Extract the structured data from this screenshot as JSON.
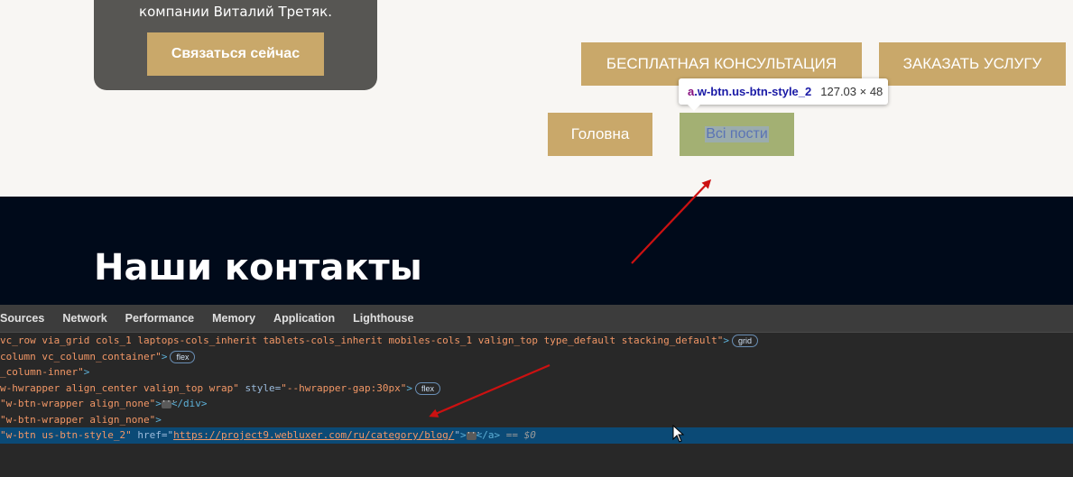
{
  "page": {
    "promo_text": "компании Виталий Третяк.",
    "contact_button": "Связаться сейчас",
    "free_consultation_button": "БЕСПЛАТНАЯ КОНСУЛЬТАЦИЯ",
    "order_service_button": "ЗАКАЗАТЬ УСЛУГУ",
    "home_button": "Головна",
    "all_posts_button": "Всі пости",
    "contacts_heading": "Наши контакты"
  },
  "tooltip": {
    "tag": "a",
    "classes": ".w-btn.us-btn-style_2",
    "size": "127.03 × 48"
  },
  "devtools": {
    "tabs": [
      "Sources",
      "Network",
      "Performance",
      "Memory",
      "Application",
      "Lighthouse"
    ],
    "lines": {
      "l1_value": " vc_row via_grid cols_1 laptops-cols_inherit tablets-cols_inherit mobiles-cols_1 valign_top type_default stacking_default\"",
      "l1_badge": "grid",
      "l2_value": "column vc_column_container\"",
      "l2_badge": "flex",
      "l3_value": "_column-inner\"",
      "l4_value": "w-hwrapper align_center valign_top wrap\"",
      "l4_attr": "style",
      "l4_style": "\"--hwrapper-gap:30px\"",
      "l4_badge": "flex",
      "l5_value": "\"w-btn-wrapper align_none\"",
      "l5_close": "</div>",
      "l6_value": "\"w-btn-wrapper align_none\"",
      "l7_value": "\"w-btn us-btn-style_2\"",
      "l7_attr": "href",
      "l7_href": "https://project9.webluxer.com/ru/category/blog/",
      "l7_close": "</a>",
      "l7_eq": "==",
      "l7_ref": "$0"
    }
  },
  "colors": {
    "gold": "#c9a86a",
    "dark_card": "#575653",
    "navy": "#000a1a",
    "annotation_arrow": "#cc1111"
  }
}
